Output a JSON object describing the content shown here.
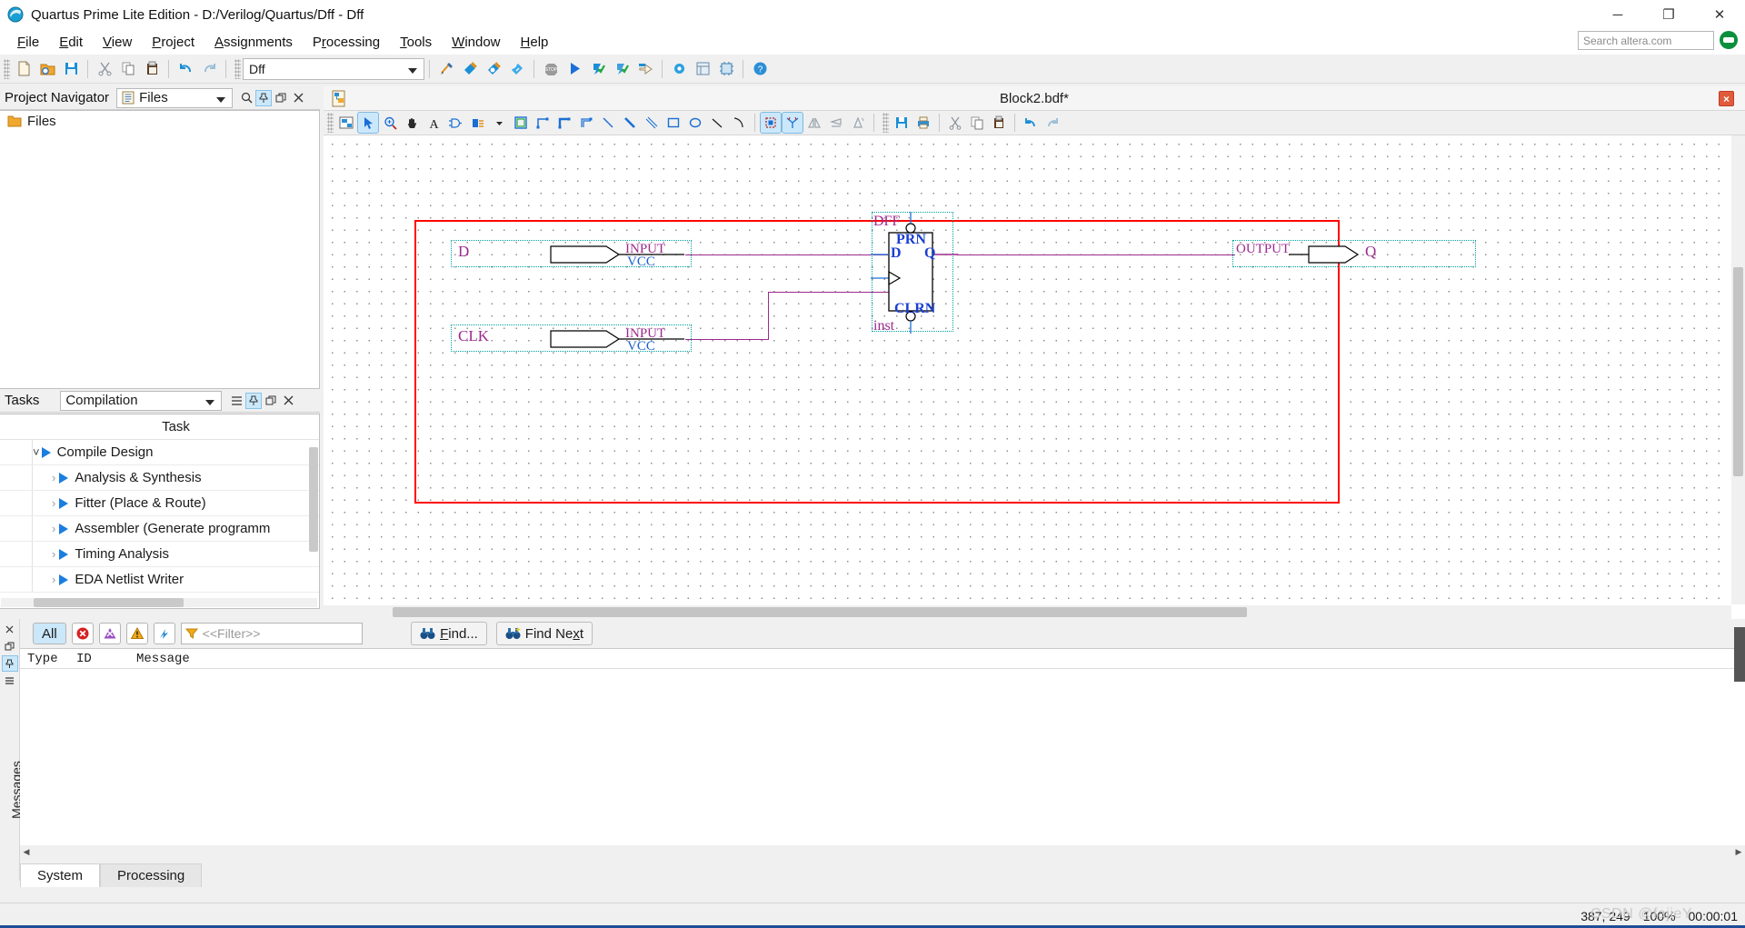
{
  "window": {
    "title": "Quartus Prime Lite Edition - D:/Verilog/Quartus/Dff - Dff",
    "app_icon": "quartus-sphere-icon",
    "minimize": "─",
    "maximize": "❐",
    "close": "✕"
  },
  "menubar": {
    "items": [
      {
        "label": "File",
        "mnemonic": "F"
      },
      {
        "label": "Edit",
        "mnemonic": "E"
      },
      {
        "label": "View",
        "mnemonic": "V"
      },
      {
        "label": "Project",
        "mnemonic": "P"
      },
      {
        "label": "Assignments",
        "mnemonic": "A"
      },
      {
        "label": "Processing",
        "mnemonic": "r"
      },
      {
        "label": "Tools",
        "mnemonic": "T"
      },
      {
        "label": "Window",
        "mnemonic": "W"
      },
      {
        "label": "Help",
        "mnemonic": "H"
      }
    ],
    "search_placeholder": "Search altera.com"
  },
  "main_toolbar": {
    "revision_value": "Dff",
    "buttons": [
      "new-file-icon",
      "open-project-icon",
      "save-icon",
      "cut-icon",
      "copy-icon",
      "paste-icon",
      "undo-icon",
      "redo-icon",
      "pin-planner-icon",
      "compile-icon",
      "analysis-synthesis-icon",
      "fitter-icon",
      "stop-icon",
      "start-compilation-icon",
      "analysis-elaboration-icon",
      "assembler-icon",
      "programmer-icon",
      "settings-icon",
      "assignment-editor-icon",
      "chip-planner-icon",
      "help-icon"
    ]
  },
  "project_navigator": {
    "title": "Project Navigator",
    "selected_view": "Files",
    "view_icon": "files-document-icon",
    "search_icon": "search-icon",
    "pin_icon": "pin-icon",
    "detach_icon": "detach-icon",
    "close_icon": "close-icon",
    "tree": [
      {
        "label": "Files",
        "icon": "folder-icon"
      }
    ]
  },
  "tasks": {
    "title": "Tasks",
    "selected_flow": "Compilation",
    "menu_icon": "list-menu-icon",
    "pin_icon": "pin-icon",
    "detach_icon": "detach-icon",
    "close_icon": "close-icon",
    "column_header": "Task",
    "rows": [
      {
        "label": "Compile Design",
        "level": 0,
        "expanded": true
      },
      {
        "label": "Analysis & Synthesis",
        "level": 1,
        "expanded": false
      },
      {
        "label": "Fitter (Place & Route)",
        "level": 1,
        "expanded": false
      },
      {
        "label": "Assembler (Generate programm",
        "level": 1,
        "expanded": false
      },
      {
        "label": "Timing Analysis",
        "level": 1,
        "expanded": false
      },
      {
        "label": "EDA Netlist Writer",
        "level": 1,
        "expanded": false
      }
    ]
  },
  "editor": {
    "tab_icon": "block-diagram-file-icon",
    "tab_title": "Block2.bdf*",
    "close_label": "×",
    "toolbar_buttons": [
      "fit-in-window-icon",
      "selection-tool-icon",
      "zoom-tool-icon",
      "hand-tool-icon",
      "text-tool-icon",
      "symbol-tool-icon",
      "block-tool-icon",
      "block-dropdown-icon",
      "rectangle-select-icon",
      "orthogonal-node-tool-icon",
      "orthogonal-bus-tool-icon",
      "orthogonal-conduit-tool-icon",
      "diagonal-node-tool-icon",
      "diagonal-bus-tool-icon",
      "diagonal-conduit-tool-icon",
      "rectangle-icon",
      "oval-icon",
      "line-icon",
      "arc-icon",
      "partition-icon",
      "rubberbanding-icon",
      "flip-horizontal-icon",
      "flip-vertical-icon",
      "rotate-icon",
      "save-icon",
      "print-icon",
      "cut-icon",
      "copy-icon",
      "paste-icon",
      "undo-icon",
      "redo-icon"
    ]
  },
  "schematic": {
    "input_d": {
      "name": "D",
      "type": "INPUT",
      "default": "VCC"
    },
    "input_clk": {
      "name": "CLK",
      "type": "INPUT",
      "default": "VCC"
    },
    "output_q": {
      "name": "Q",
      "type": "OUTPUT"
    },
    "dff": {
      "title": "DFF",
      "instance": "inst",
      "port_d": "D",
      "port_q": "Q",
      "port_prn": "PRN",
      "port_clrn": "CLRN"
    },
    "selection_color": "#ff0000",
    "wire_color": "#9c2a8e",
    "pin_outline_color": "#00a0a0"
  },
  "messages": {
    "panel_label": "Messages",
    "filters": {
      "all_label": "All",
      "error_icon": "error-icon",
      "critical-warning_icon": "critical-warning-icon",
      "warning_icon": "warning-icon",
      "info_icon": "info-icon"
    },
    "filter_icon": "funnel-icon",
    "filter_placeholder": "<<Filter>>",
    "find_label": "Find...",
    "find_next_label": "Find Next",
    "find_icon": "binoculars-icon",
    "find_next_icon": "binoculars-next-icon",
    "columns": [
      "Type",
      "ID",
      "Message"
    ],
    "rows": [],
    "tabs": [
      {
        "label": "System",
        "active": true
      },
      {
        "label": "Processing",
        "active": false
      }
    ],
    "side_buttons": [
      "close-icon",
      "detach-icon",
      "pin-icon",
      "list-menu-icon"
    ]
  },
  "statusbar": {
    "coordinates": "387, 249",
    "zoom": "100%",
    "elapsed_time": "00:00:01",
    "watermark": "CSDN @fajieY"
  }
}
